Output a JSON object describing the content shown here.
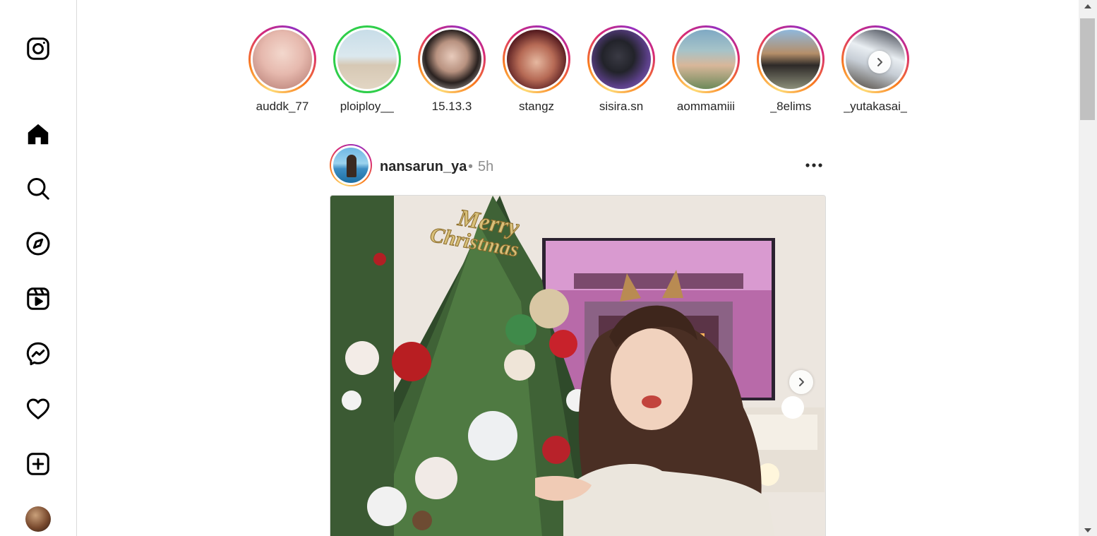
{
  "app": {
    "name": "Instagram"
  },
  "sidebar": {
    "items": [
      {
        "icon": "home-icon",
        "label": "Home"
      },
      {
        "icon": "search-icon",
        "label": "Search"
      },
      {
        "icon": "explore-icon",
        "label": "Explore"
      },
      {
        "icon": "reels-icon",
        "label": "Reels"
      },
      {
        "icon": "messenger-icon",
        "label": "Messages"
      },
      {
        "icon": "heart-icon",
        "label": "Notifications"
      },
      {
        "icon": "create-icon",
        "label": "Create"
      },
      {
        "icon": "profile-avatar",
        "label": "Profile"
      }
    ]
  },
  "stories": [
    {
      "username": "auddk_77",
      "ring": "gradient"
    },
    {
      "username": "ploiploy__",
      "ring": "close-friends"
    },
    {
      "username": "15.13.3",
      "ring": "gradient"
    },
    {
      "username": "stangz",
      "ring": "gradient"
    },
    {
      "username": "sisira.sn",
      "ring": "gradient"
    },
    {
      "username": "aommamiii",
      "ring": "gradient"
    },
    {
      "username": "_8elims",
      "ring": "gradient"
    },
    {
      "username": "_yutakasai_",
      "ring": "gradient"
    }
  ],
  "post": {
    "username": "nansarun_ya",
    "separator": "•",
    "time": "5h",
    "image_text": "Merry Christmas",
    "more_icon": "more-horizontal-icon"
  },
  "colors": {
    "story_gradient": [
      "#feda75",
      "#fa7e1e",
      "#d62976",
      "#962fbf"
    ],
    "close_friends": "#2fce4a",
    "border": "#dbdbdb",
    "secondary_text": "#8e8e8e"
  }
}
